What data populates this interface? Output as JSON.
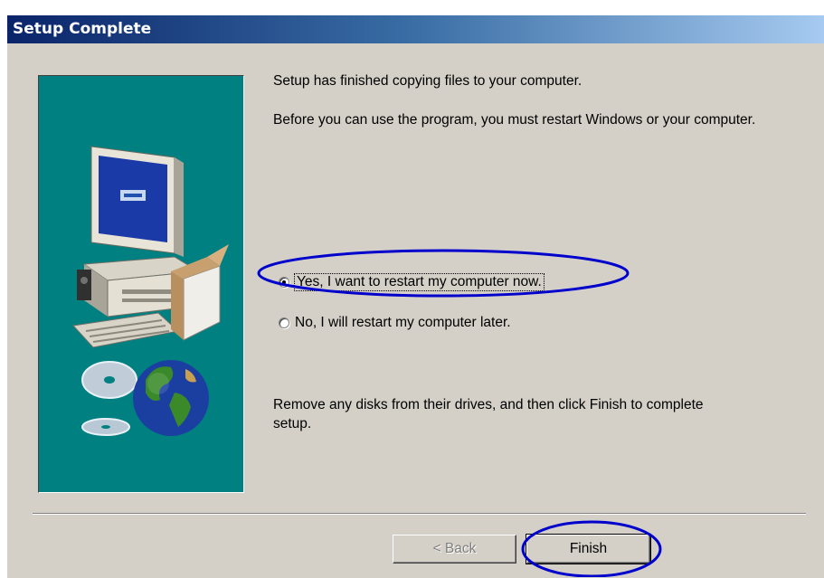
{
  "window": {
    "title": "Setup Complete"
  },
  "messages": {
    "copied": "Setup has finished copying files to your computer.",
    "restart_required": "Before you can use the program, you must restart Windows or your computer.",
    "remove_disks": "Remove any disks from their drives, and then click Finish to complete setup."
  },
  "options": {
    "restart_now": {
      "label": "Yes, I want to restart my computer now.",
      "checked": true
    },
    "restart_later": {
      "label": "No, I will restart my computer later.",
      "checked": false
    }
  },
  "buttons": {
    "back": {
      "label": "< Back",
      "enabled": false
    },
    "finish": {
      "label": "Finish",
      "enabled": true
    }
  },
  "colors": {
    "title_gradient_start": "#0a246a",
    "title_gradient_end": "#a6caf0",
    "dialog_face": "#d4d0c8",
    "side_panel": "#008080",
    "annotation": "#0000cc"
  },
  "icons": [
    "computer-icon",
    "software-box-icon",
    "cd-disc-icon",
    "globe-icon"
  ]
}
